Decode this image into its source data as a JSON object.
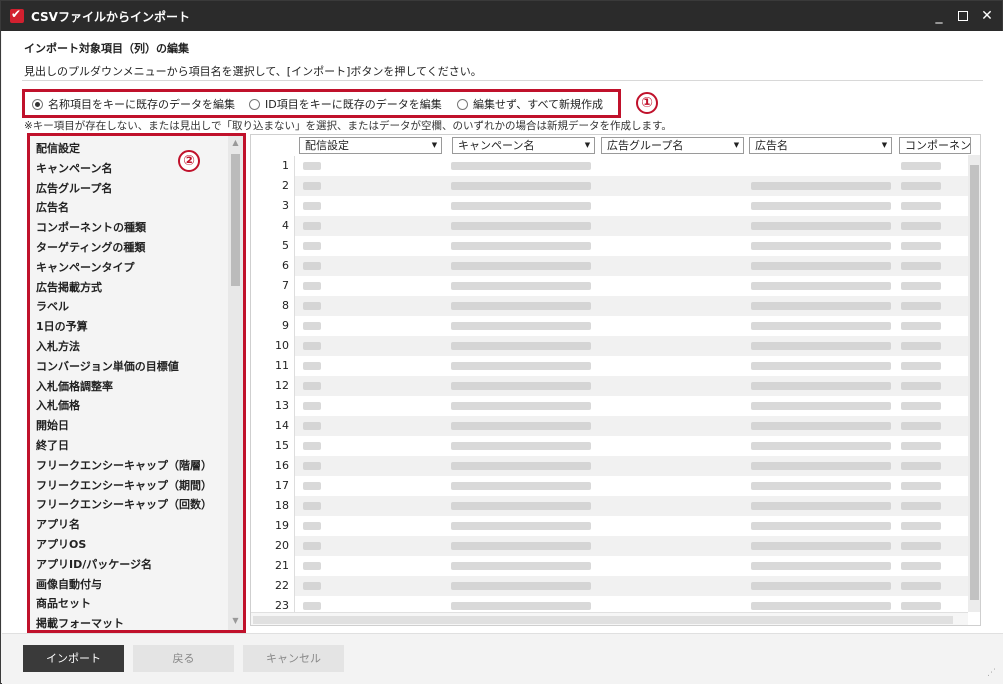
{
  "window": {
    "title": "CSVファイルからインポート"
  },
  "page": {
    "heading": "インポート対象項目（列）の編集",
    "description": "見出しのプルダウンメニューから項目名を選択して、[インポート]ボタンを押してください。",
    "note": "※キー項目が存在しない、または見出しで「取り込まない」を選択、またはデータが空欄、のいずれかの場合は新規データを作成します。"
  },
  "radio_options": [
    {
      "label": "名称項目をキーに既存のデータを編集",
      "checked": true
    },
    {
      "label": "ID項目をキーに既存のデータを編集",
      "checked": false
    },
    {
      "label": "編集せず、すべて新規作成",
      "checked": false
    }
  ],
  "callouts": {
    "one": "①",
    "two": "②"
  },
  "field_list": [
    "配信設定",
    "キャンペーン名",
    "広告グループ名",
    "広告名",
    "コンポーネントの種類",
    "ターゲティングの種類",
    "キャンペーンタイプ",
    "広告掲載方式",
    "ラベル",
    "1日の予算",
    "入札方法",
    "コンバージョン単価の目標値",
    "入札価格調整率",
    "入札価格",
    "開始日",
    "終了日",
    "フリークエンシーキャップ（階層）",
    "フリークエンシーキャップ（期間）",
    "フリークエンシーキャップ（回数）",
    "アプリ名",
    "アプリOS",
    "アプリID/パッケージ名",
    "画像自動付与",
    "商品セット",
    "掲載フォーマット"
  ],
  "grid": {
    "columns": [
      "配信設定",
      "キャンペーン名",
      "広告グループ名",
      "広告名",
      "コンポーネン"
    ],
    "row_numbers": [
      "1",
      "2",
      "3",
      "4",
      "5",
      "6",
      "7",
      "8",
      "9",
      "10",
      "11",
      "12",
      "13",
      "14",
      "15",
      "16",
      "17",
      "18",
      "19",
      "20",
      "21",
      "22",
      "23"
    ]
  },
  "footer": {
    "import": "インポート",
    "back": "戻る",
    "cancel": "キャンセル"
  },
  "icons": {
    "app": "app-logo-icon",
    "dropdown": "▼",
    "minimize": "_",
    "close": "✕",
    "scroll_up": "▲",
    "scroll_down": "▼",
    "scroll_right": "►",
    "resize": "⋰"
  },
  "colors": {
    "highlight": "#c0112b",
    "titlebar": "#2b2b2b",
    "primary_button": "#3a3a3a"
  }
}
